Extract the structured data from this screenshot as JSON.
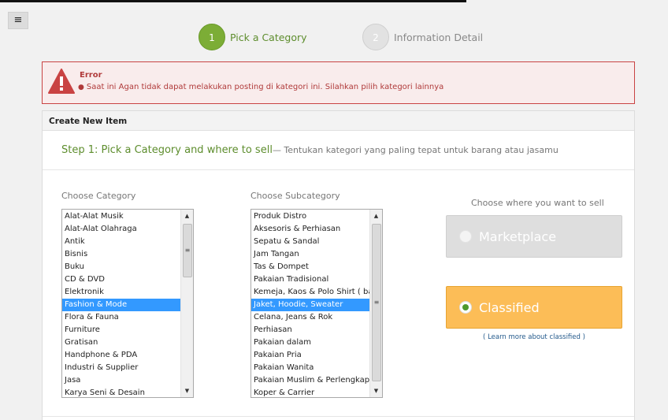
{
  "steps": [
    {
      "number": "1",
      "label": "Pick a Category",
      "active": true
    },
    {
      "number": "2",
      "label": "Information Detail",
      "active": false
    }
  ],
  "error": {
    "title": "Error",
    "message": "Saat ini Agan tidak dapat melakukan posting di kategori ini. Silahkan pilih kategori lainnya",
    "icon": "warning-icon",
    "color": "#c94343"
  },
  "panel": {
    "title": "Create New Item",
    "step_title": "Step 1: Pick a Category and where to sell",
    "step_subtitle": "— Tentukan kategori yang paling tepat untuk barang atau jasamu"
  },
  "category": {
    "label": "Choose Category",
    "items": [
      "Alat-Alat Musik",
      "Alat-Alat Olahraga",
      "Antik",
      "Bisnis",
      "Buku",
      "CD & DVD",
      "Elektronik",
      "Fashion & Mode",
      "Flora & Fauna",
      "Furniture",
      "Gratisan",
      "Handphone & PDA",
      "Industri & Supplier",
      "Jasa",
      "Karya Seni & Desain"
    ],
    "selected": "Fashion & Mode"
  },
  "subcategory": {
    "label": "Choose Subcategory",
    "items": [
      "Produk Distro",
      "Aksesoris & Perhiasan",
      "Sepatu & Sandal",
      "Jam Tangan",
      "Tas & Dompet",
      "Pakaian Tradisional",
      "Kemeja, Kaos & Polo Shirt ( baju )",
      "Jaket, Hoodie, Sweater",
      "Celana, Jeans & Rok",
      "Perhiasan",
      "Pakaian dalam",
      "Pakaian Pria",
      "Pakaian Wanita",
      "Pakaian Muslim & Perlengkapan",
      "Koper & Carrier"
    ],
    "selected": "Jaket, Hoodie, Sweater"
  },
  "sell": {
    "label": "Choose where you want to sell",
    "options": [
      {
        "label": "Marketplace",
        "selected": false
      },
      {
        "label": "Classified",
        "selected": true
      }
    ],
    "learn_more": "Learn more about classified",
    "learn_prefix": "( ",
    "learn_suffix": " )"
  },
  "menu": {
    "icon": "hamburger-icon",
    "glyph": "≡"
  },
  "colors": {
    "accent_green": "#7cad36",
    "classified_orange": "#fcbd57",
    "selection_blue": "#3399ff"
  }
}
